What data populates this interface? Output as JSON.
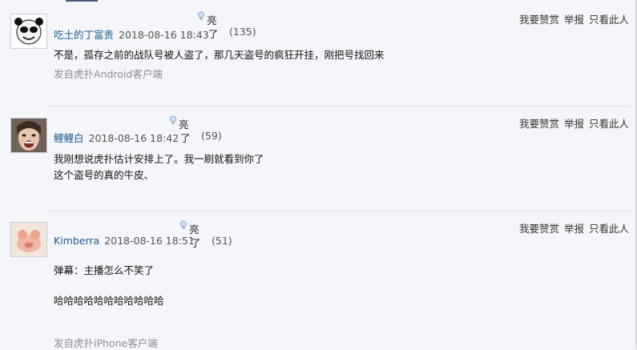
{
  "actions": {
    "reward": "我要赞赏",
    "report": "举报",
    "only_this": "只看此人"
  },
  "light_label": "亮",
  "light_suffix": "了",
  "posts": [
    {
      "username": "吃土的丁富贵",
      "time": "2018-08-16 18:43",
      "light_count": "(135)",
      "lines": [
        "不是，孤存之前的战队号被人盗了，那几天盗号的疯狂开挂，刚把号找回来"
      ],
      "source": "发自虎扑Android客户端"
    },
    {
      "username": "鲤鲤白",
      "time": "2018-08-16 18:42",
      "light_count": "(59)",
      "lines": [
        "我刚想说虎扑估计安排上了。我一刷就看到你了",
        "这个盗号的真的牛皮、"
      ],
      "source": ""
    },
    {
      "username": "Kimberra",
      "time": "2018-08-16 18:51",
      "light_count": "(51)",
      "lines": [
        "弹幕：主播怎么不笑了",
        "",
        "哈哈哈哈哈哈哈哈哈哈哈"
      ],
      "source": "发自虎扑iPhone客户端"
    }
  ]
}
